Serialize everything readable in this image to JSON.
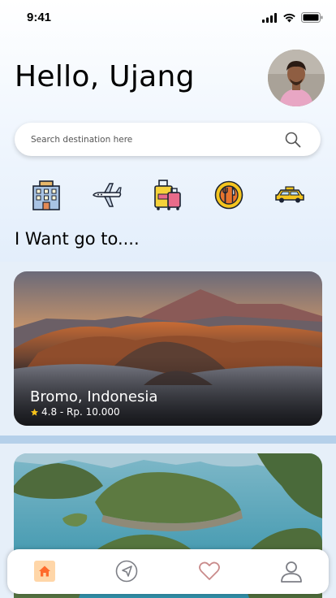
{
  "status_bar": {
    "time": "9:41",
    "icons": [
      "signal-icon",
      "wifi-icon",
      "battery-icon"
    ]
  },
  "header": {
    "greeting": "Hello, Ujang"
  },
  "search": {
    "placeholder": "Search destination here"
  },
  "categories": [
    {
      "icon": "hotel-icon"
    },
    {
      "icon": "airplane-icon"
    },
    {
      "icon": "luggage-icon"
    },
    {
      "icon": "restaurant-icon"
    },
    {
      "icon": "taxi-icon"
    }
  ],
  "section": {
    "title": "I Want go to...."
  },
  "destinations": [
    {
      "name": "Bromo, Indonesia",
      "rating": "4.8",
      "price": "Rp. 10.000",
      "meta": "4.8 - Rp. 10.000"
    },
    {
      "name": "",
      "meta": ""
    }
  ],
  "bottom_nav": {
    "items": [
      "home-icon",
      "navigate-icon",
      "heart-icon",
      "profile-icon"
    ],
    "active": "home-icon"
  },
  "colors": {
    "accent": "#ff6a2b",
    "star": "#f7c31b",
    "nav_icon": "#7d7f86"
  }
}
